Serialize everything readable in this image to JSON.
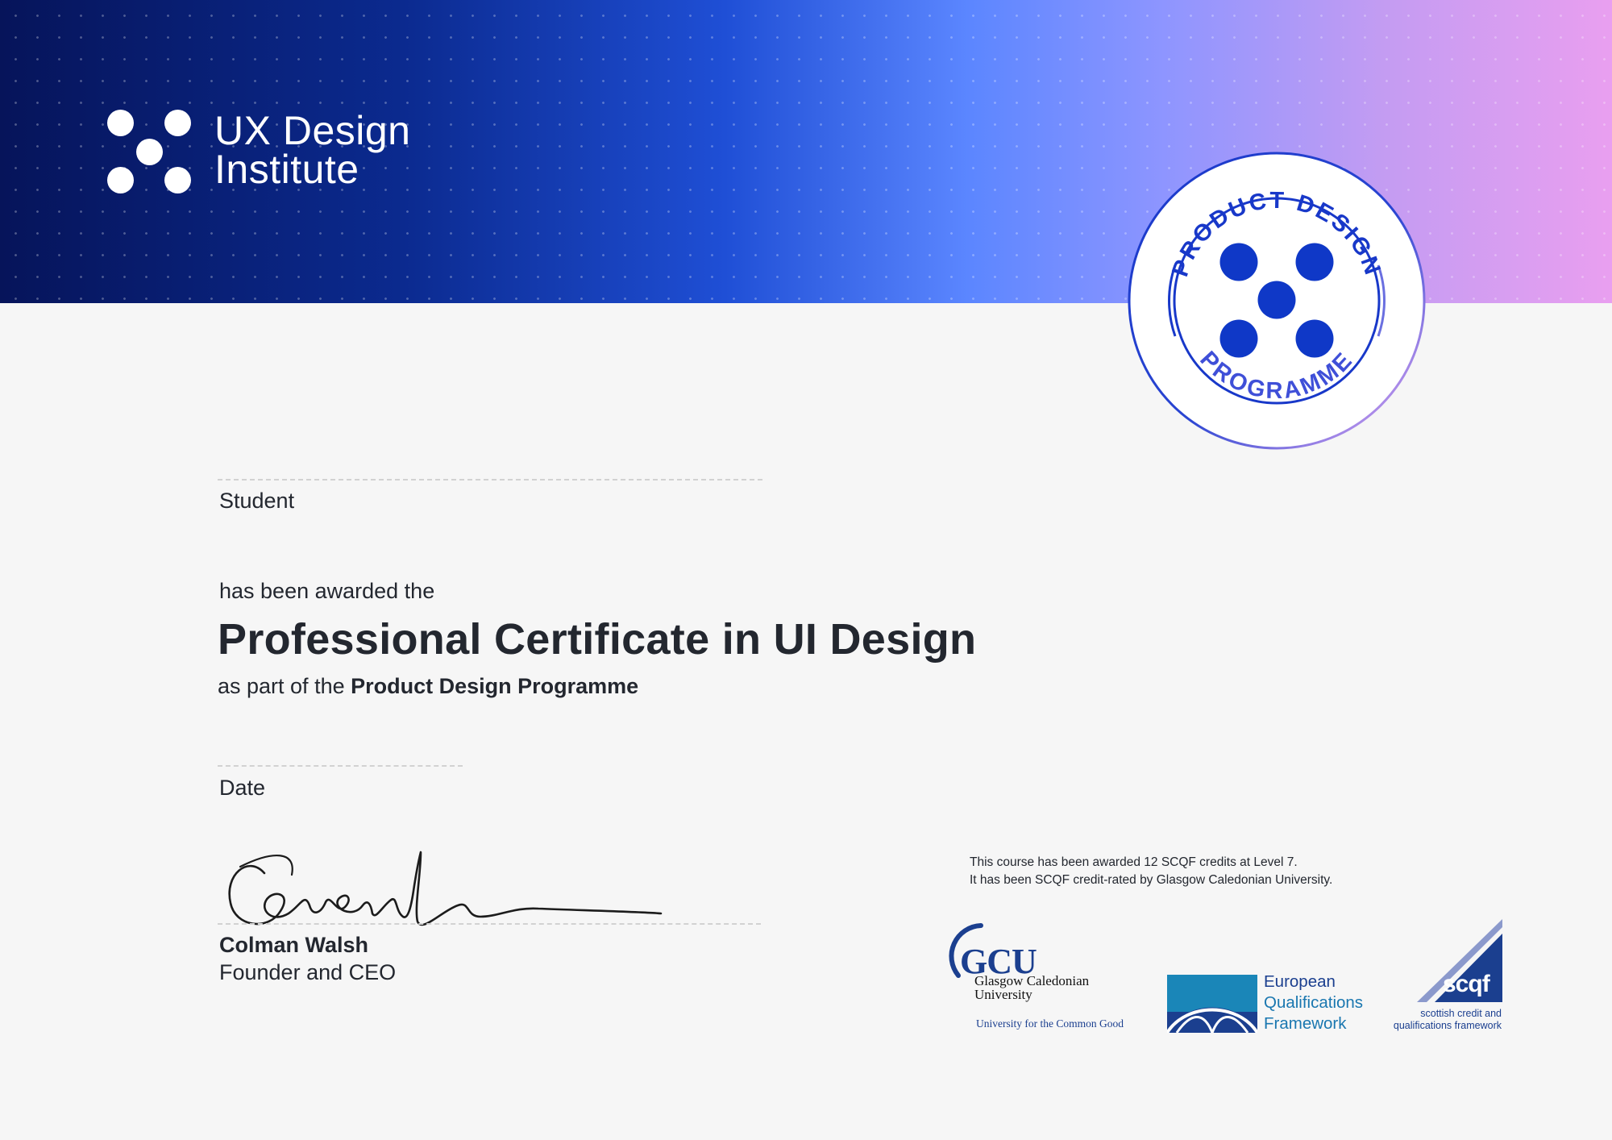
{
  "brand": {
    "line1": "UX Design",
    "line2": "Institute"
  },
  "seal": {
    "top_text": "PRODUCT DESIGN",
    "bottom_text": "PROGRAMME"
  },
  "student": {
    "label": "Student"
  },
  "award": {
    "intro": "has been awarded the",
    "title": "Professional Certificate in UI Design",
    "part_of_prefix": "as part of the",
    "programme": "Product Design Programme"
  },
  "date": {
    "label": "Date"
  },
  "signer": {
    "name": "Colman Walsh",
    "role": "Founder and CEO"
  },
  "credit_note": {
    "line1": "This course has been awarded 12 SCQF credits at Level 7.",
    "line2": "It has been SCQF credit-rated by Glasgow Caledonian University."
  },
  "gcu": {
    "letters": "GCU",
    "name_line1": "Glasgow Caledonian",
    "name_line2": "University",
    "tagline": "University for the Common Good"
  },
  "eqf": {
    "line1": "European",
    "line2": "Qualifications",
    "line3": "Framework"
  },
  "scqf": {
    "word": "scqf",
    "tag_line1": "scottish credit and",
    "tag_line2": "qualifications framework"
  },
  "colors": {
    "brand_blue": "#0f38c7",
    "header_start": "#06145a",
    "header_end": "#e99ff0",
    "text": "#23272f"
  }
}
